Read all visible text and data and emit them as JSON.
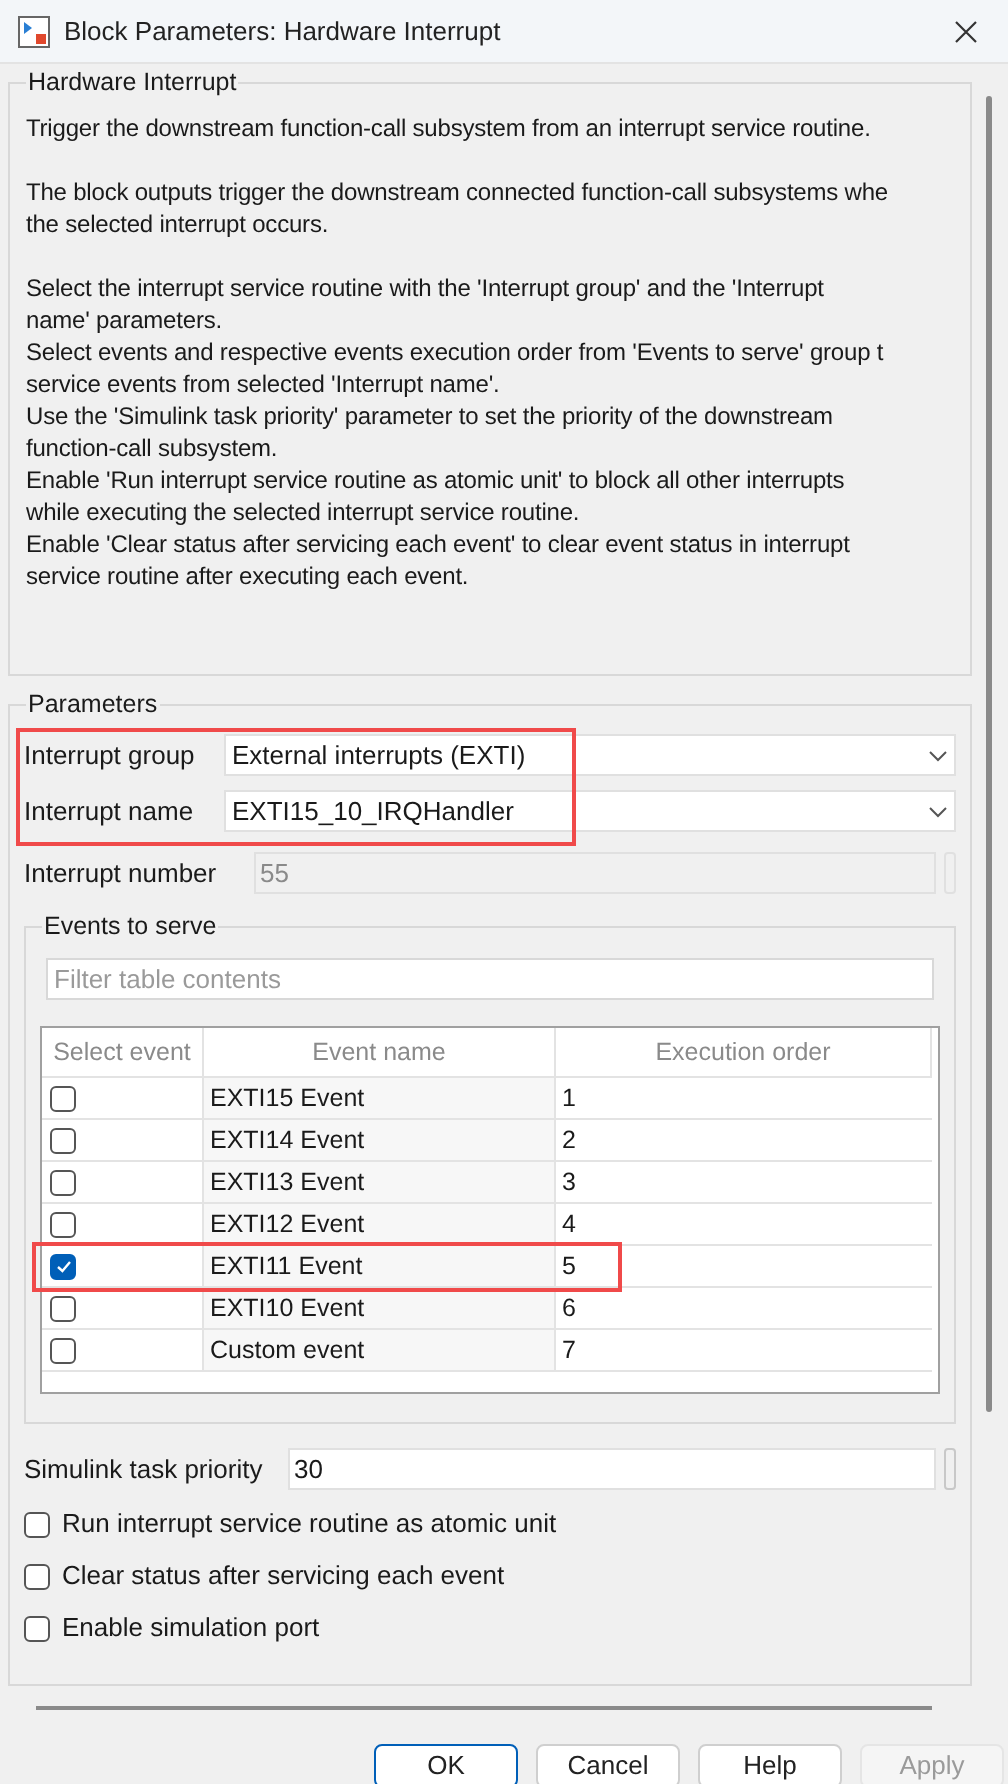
{
  "window": {
    "title": "Block Parameters: Hardware Interrupt"
  },
  "description": {
    "title": "Hardware Interrupt",
    "paragraphs": [
      [
        "Trigger the downstream function-call subsystem from an interrupt service routine."
      ],
      [
        "The block outputs trigger the downstream connected function-call subsystems whe",
        "the selected interrupt occurs."
      ],
      [
        "Select the interrupt service routine with the 'Interrupt group' and the 'Interrupt",
        "name' parameters.",
        "Select events and respective events execution order from 'Events to serve' group t",
        "service events from selected 'Interrupt name'.",
        "Use the 'Simulink task priority' parameter to set the priority of the downstream",
        "function-call subsystem.",
        "Enable 'Run interrupt service routine as atomic unit' to block all other interrupts",
        "while executing the selected interrupt service routine.",
        "Enable 'Clear status after servicing each event' to clear event status in interrupt",
        "service routine after executing each event."
      ]
    ]
  },
  "parameters": {
    "title": "Parameters",
    "highlighted": true,
    "interrupt_group": {
      "label": "Interrupt group",
      "value": "External interrupts (EXTI)"
    },
    "interrupt_name": {
      "label": "Interrupt name",
      "value": "EXTI15_10_IRQHandler"
    },
    "interrupt_number": {
      "label": "Interrupt number",
      "value": "55",
      "disabled": true
    },
    "events": {
      "title": "Events to serve",
      "filter_placeholder": "Filter table contents",
      "columns": [
        "Select event",
        "Event name",
        "Execution order"
      ],
      "rows": [
        {
          "checked": false,
          "name": "EXTI15 Event",
          "order": "1",
          "highlighted": false
        },
        {
          "checked": false,
          "name": "EXTI14 Event",
          "order": "2",
          "highlighted": false
        },
        {
          "checked": false,
          "name": "EXTI13 Event",
          "order": "3",
          "highlighted": false
        },
        {
          "checked": false,
          "name": "EXTI12 Event",
          "order": "4",
          "highlighted": false
        },
        {
          "checked": true,
          "name": "EXTI11 Event",
          "order": "5",
          "highlighted": true
        },
        {
          "checked": false,
          "name": "EXTI10 Event",
          "order": "6",
          "highlighted": false
        },
        {
          "checked": false,
          "name": "Custom event",
          "order": "7",
          "highlighted": false
        }
      ]
    },
    "task_priority": {
      "label": "Simulink task priority",
      "value": "30"
    },
    "options": [
      {
        "label": "Run interrupt service routine as atomic unit",
        "checked": false
      },
      {
        "label": "Clear status after servicing each event",
        "checked": false
      },
      {
        "label": "Enable simulation port",
        "checked": false
      }
    ]
  },
  "buttons": [
    {
      "label": "OK",
      "disabled": false,
      "default": true
    },
    {
      "label": "Cancel",
      "disabled": false,
      "default": false
    },
    {
      "label": "Help",
      "disabled": false,
      "default": false
    },
    {
      "label": "Apply",
      "disabled": true,
      "default": false
    }
  ]
}
